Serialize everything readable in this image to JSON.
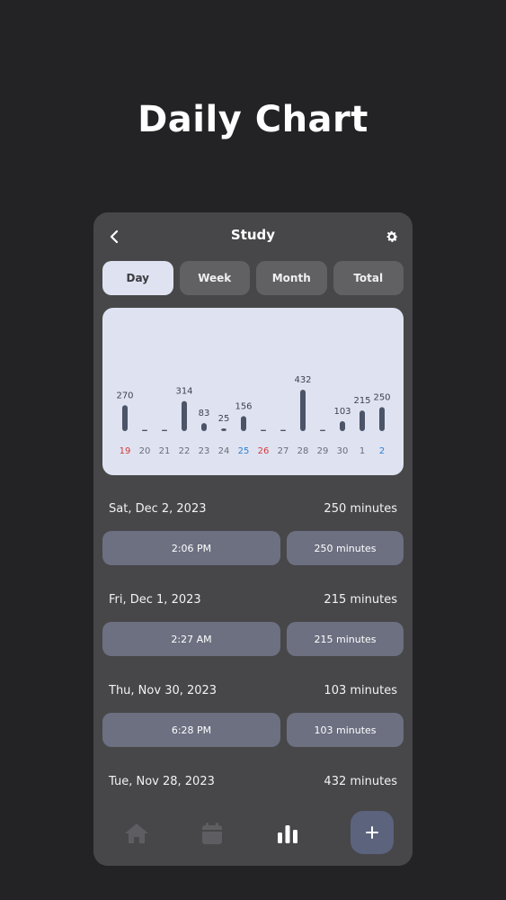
{
  "hero_title": "Daily Chart",
  "screen_title": "Study",
  "icons": {
    "back": "chevron-left-icon",
    "settings": "gear-icon",
    "home": "home-icon",
    "calendar": "calendar-icon",
    "chart": "bar-chart-icon",
    "add": "plus-icon"
  },
  "tabs": [
    {
      "label": "Day",
      "active": true
    },
    {
      "label": "Week",
      "active": false
    },
    {
      "label": "Month",
      "active": false
    },
    {
      "label": "Total",
      "active": false
    }
  ],
  "colors": {
    "background": "#232224",
    "phone": "#474749",
    "chart_card": "#dfe3f1",
    "bar": "#4c5468",
    "saturday": "#2b7fd4",
    "sunday": "#d43a3a",
    "weekday": "#6a6e78"
  },
  "chart_data": {
    "type": "bar",
    "categories": [
      "19",
      "20",
      "21",
      "22",
      "23",
      "24",
      "25",
      "26",
      "27",
      "28",
      "29",
      "30",
      "1",
      "2"
    ],
    "values": [
      270,
      0,
      0,
      314,
      83,
      25,
      156,
      0,
      0,
      432,
      0,
      103,
      215,
      250
    ],
    "value_labels": [
      "270",
      "",
      "",
      "314",
      "83",
      "25",
      "156",
      "",
      "",
      "432",
      "",
      "103",
      "215",
      "250"
    ],
    "category_colors": [
      "sunday",
      "weekday",
      "weekday",
      "weekday",
      "weekday",
      "weekday",
      "saturday",
      "sunday",
      "weekday",
      "weekday",
      "weekday",
      "weekday",
      "weekday",
      "saturday"
    ],
    "ylim": [
      0,
      432
    ]
  },
  "days": [
    {
      "date": "Sat, Dec 2, 2023",
      "total": "250 minutes",
      "sessions": [
        {
          "time": "2:06 PM",
          "duration": "250 minutes"
        }
      ]
    },
    {
      "date": "Fri, Dec 1, 2023",
      "total": "215 minutes",
      "sessions": [
        {
          "time": "2:27 AM",
          "duration": "215 minutes"
        }
      ]
    },
    {
      "date": "Thu, Nov 30, 2023",
      "total": "103 minutes",
      "sessions": [
        {
          "time": "6:28 PM",
          "duration": "103 minutes"
        }
      ]
    },
    {
      "date": "Tue, Nov 28, 2023",
      "total": "432 minutes",
      "sessions": []
    }
  ]
}
